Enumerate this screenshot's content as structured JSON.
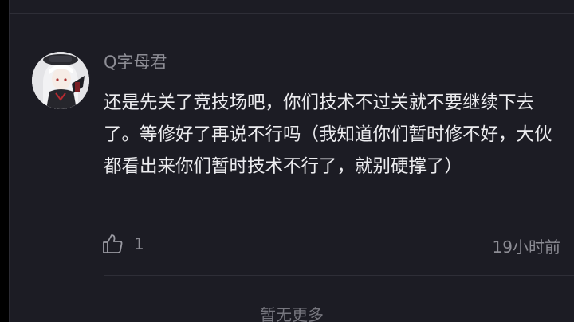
{
  "comment": {
    "username": "Q字母君",
    "text": "还是先关了竞技场吧，你们技术不过关就不要继续下去了。等修好了再说不行吗（我知道你们暂时修不好，大伙都看出来你们暂时技术不行了，就别硬撑了）",
    "likes": "1",
    "time": "19小时前"
  },
  "footer": {
    "no_more": "暂无更多"
  },
  "icons": {
    "like": "thumbs-up-icon"
  },
  "colors": {
    "background": "#1c1c24",
    "text_primary": "#ececef",
    "text_secondary": "#8d8d95"
  }
}
